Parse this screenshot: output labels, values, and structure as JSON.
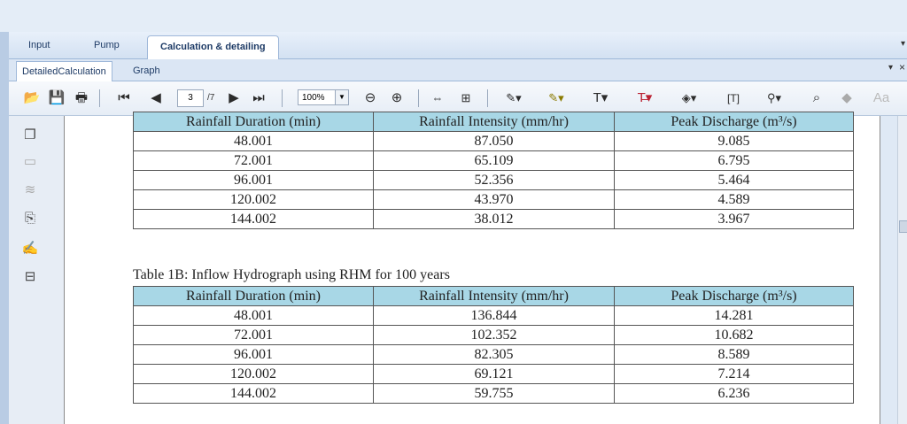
{
  "outer_tabs": [
    "Input",
    "Pump",
    "Calculation & detailing"
  ],
  "inner_tabs": [
    "DetailedCalculation",
    "Graph"
  ],
  "toolbar": {
    "page_current": "3",
    "page_total": "/7",
    "zoom": "100%"
  },
  "table1": {
    "headers": [
      "Rainfall Duration (min)",
      "Rainfall Intensity (mm/hr)",
      "Peak Discharge (m³/s)"
    ],
    "rows": [
      [
        "48.001",
        "87.050",
        "9.085"
      ],
      [
        "72.001",
        "65.109",
        "6.795"
      ],
      [
        "96.001",
        "52.356",
        "5.464"
      ],
      [
        "120.002",
        "43.970",
        "4.589"
      ],
      [
        "144.002",
        "38.012",
        "3.967"
      ]
    ]
  },
  "table2": {
    "caption": "Table 1B: Inflow Hydrograph using RHM for 100 years",
    "headers": [
      "Rainfall Duration (min)",
      "Rainfall Intensity (mm/hr)",
      "Peak Discharge (m³/s)"
    ],
    "rows": [
      [
        "48.001",
        "136.844",
        "14.281"
      ],
      [
        "72.001",
        "102.352",
        "10.682"
      ],
      [
        "96.001",
        "82.305",
        "8.589"
      ],
      [
        "120.002",
        "69.121",
        "7.214"
      ],
      [
        "144.002",
        "59.755",
        "6.236"
      ]
    ]
  },
  "colors": {
    "header_fill": "#a8d7e6",
    "tab_text": "#1e3b66"
  }
}
